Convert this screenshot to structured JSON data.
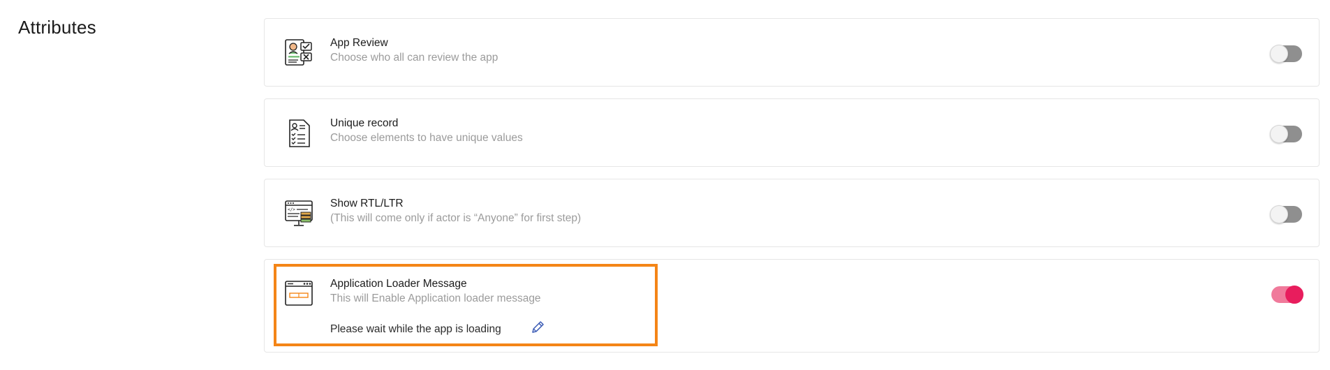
{
  "section": {
    "title": "Attributes"
  },
  "cards": [
    {
      "title": "App Review",
      "subtitle": "Choose who all can review the app",
      "icon": "app-review-icon",
      "toggle_on": false
    },
    {
      "title": "Unique record",
      "subtitle": "Choose elements to have unique values",
      "icon": "unique-record-icon",
      "toggle_on": false
    },
    {
      "title": "Show RTL/LTR",
      "subtitle": "(This will come only if actor is “Anyone” for first step)",
      "icon": "rtl-ltr-icon",
      "toggle_on": false
    },
    {
      "title": "Application Loader Message",
      "subtitle": "This will Enable Application loader message",
      "icon": "loader-window-icon",
      "toggle_on": true,
      "message": "Please wait while the app is loading"
    }
  ],
  "colors": {
    "toggle_off_track": "#8f8f8f",
    "toggle_on_track": "#f07a9b",
    "toggle_on_knob": "#e81d5d",
    "highlight_border": "#f48517",
    "edit_icon": "#3b5bb5"
  }
}
